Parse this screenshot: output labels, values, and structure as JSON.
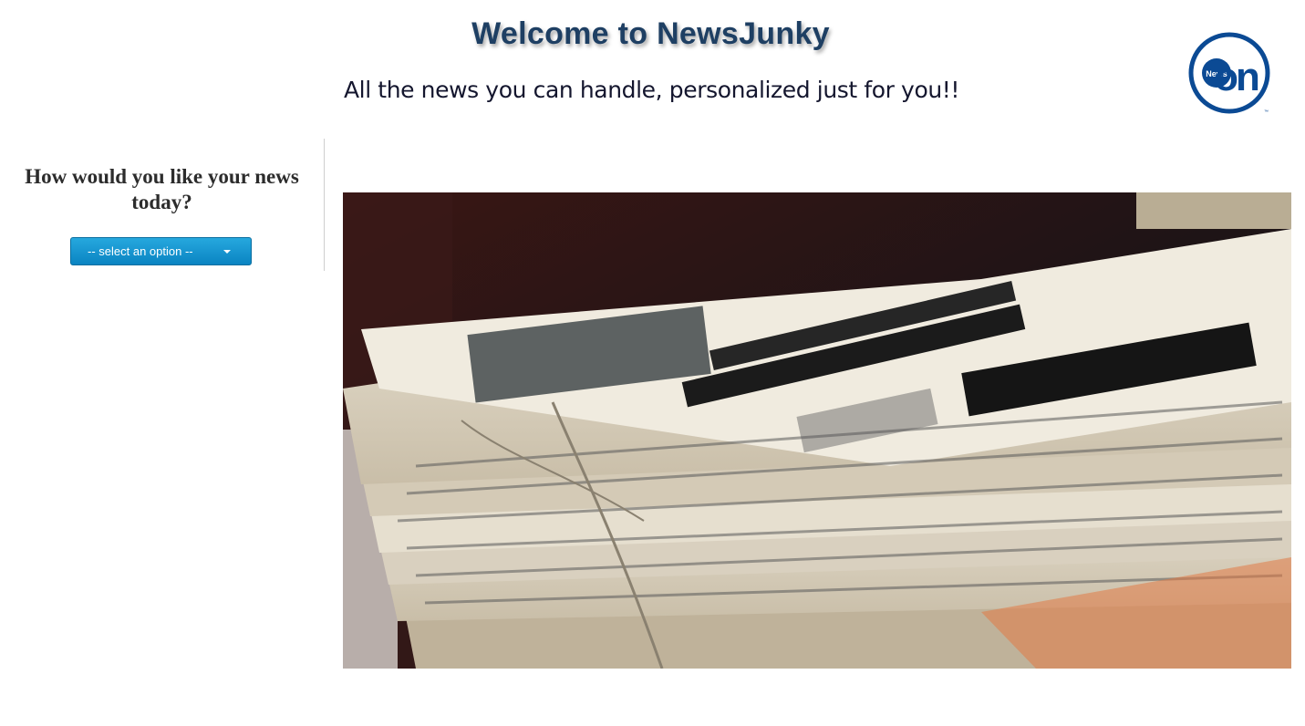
{
  "header": {
    "title": "Welcome to NewsJunky",
    "tagline": "All the news you can handle, personalized just for you!!"
  },
  "logo": {
    "badge_text": "News",
    "word": "on",
    "mark": "™",
    "color": "#0b4a94"
  },
  "sidebar": {
    "heading": "How would you like your news today?",
    "select": {
      "selected": "-- select an option --",
      "icon": "chevron-down-icon"
    }
  },
  "hero_image": {
    "subject": "newspapers-stack"
  },
  "colors": {
    "title": "#1e3f63",
    "tagline": "#14162e",
    "select_bg": "#0a84c2"
  }
}
